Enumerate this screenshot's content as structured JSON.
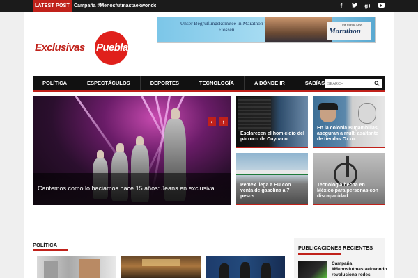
{
  "topbar": {
    "latest_label": "LATEST POST",
    "ticker_text": "Campaña #Menosfutmastaekwondo revolu",
    "social": [
      {
        "icon": "facebook-icon",
        "glyph": "f"
      },
      {
        "icon": "twitter-icon",
        "glyph": "t"
      },
      {
        "icon": "google-plus-icon",
        "glyph": "g+"
      },
      {
        "icon": "youtube-icon",
        "glyph": ""
      }
    ]
  },
  "logo": {
    "part1": "Exclusivas",
    "part2": "Puebla"
  },
  "banner": {
    "text": "Unser Begrüßungskomitee in Marathon trägt Flossen.",
    "logo_top": "The Florida Keys",
    "logo_main": "Marathon"
  },
  "nav": {
    "items": [
      "POLÍTICA",
      "ESPECTÁCULOS",
      "DEPORTES",
      "TECNOLOGÍA",
      "A DÓNDE IR",
      "SABÍAS QUE"
    ],
    "search_placeholder": "SEARCH"
  },
  "hero": {
    "caption": "Cantemos como lo haciamos hace 15 años: Jeans en exclusiva.",
    "prev_glyph": "‹",
    "next_glyph": "›"
  },
  "thumbs": [
    {
      "title": "Esclarecen el homicidio del párroco de Cuyoaco."
    },
    {
      "title": "En la colonia Bugambilias, aseguran a multi asaltante de tiendas Oxxo."
    },
    {
      "title": "Pemex llega a EU con venta de gasolina a 7 pesos"
    },
    {
      "title": "Tecnología hecha en México para personas con discapacidad"
    }
  ],
  "section": {
    "title": "POLÍTICA"
  },
  "sidebar": {
    "title": "PUBLICACIONES RECIENTES",
    "recent": [
      {
        "title": "Campaña #Menosfutmastaekwondo revoluciona redes sociales"
      }
    ]
  },
  "colors": {
    "accent": "#c0211a",
    "dark": "#111111",
    "topbar": "#1b1b1b"
  }
}
